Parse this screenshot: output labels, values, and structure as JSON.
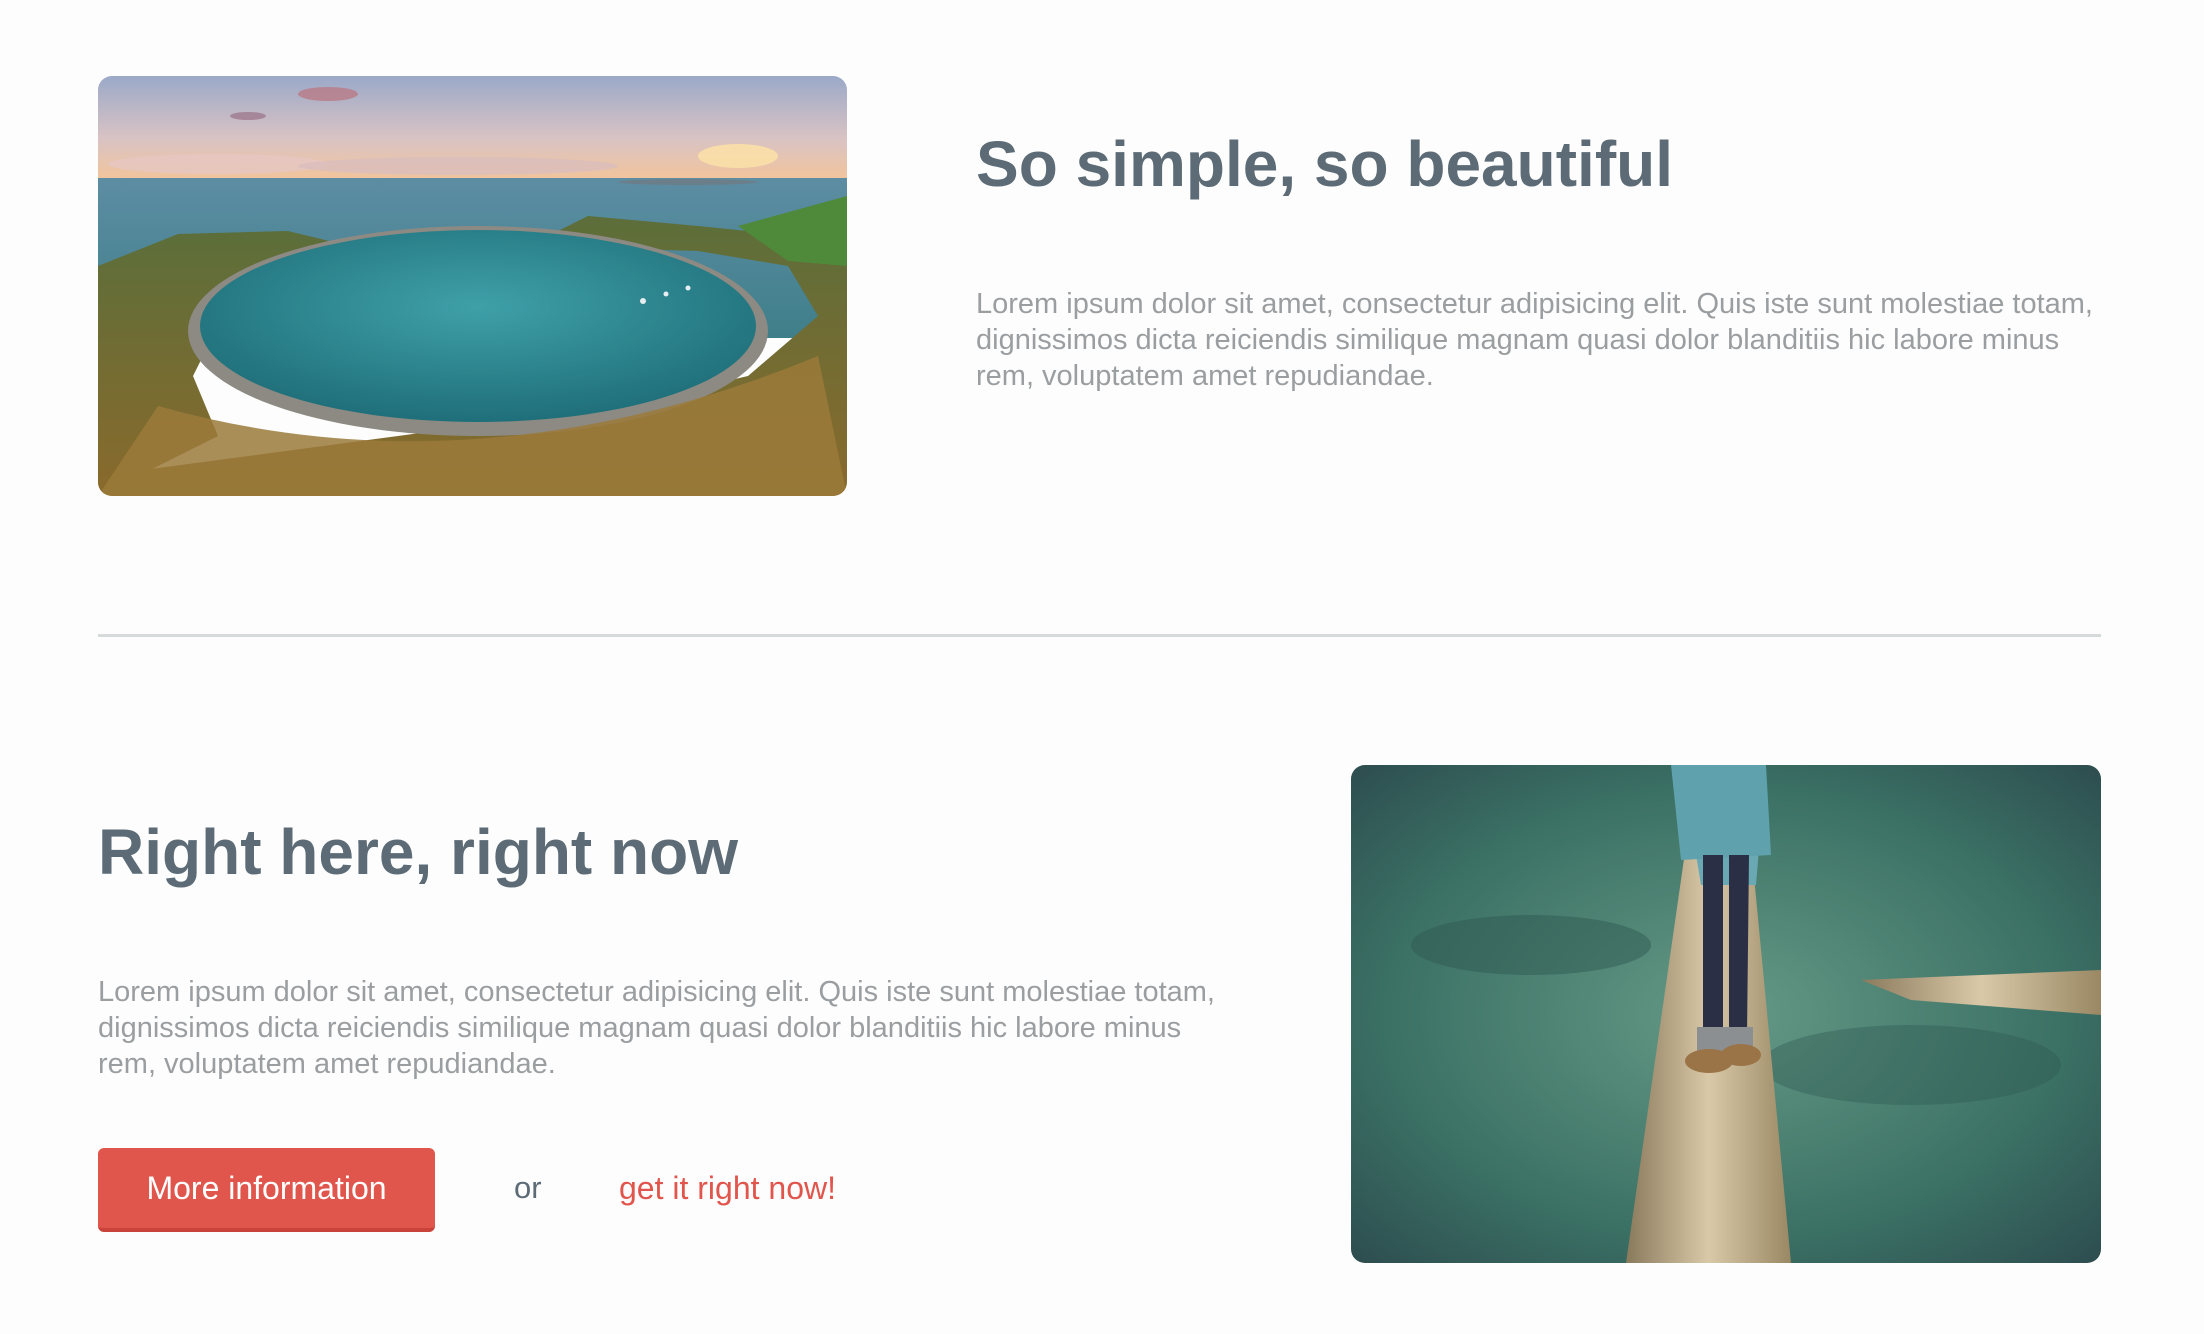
{
  "section_one": {
    "heading": "So simple, so beautiful",
    "body": "Lorem ipsum dolor sit amet, consectetur adipisicing elit. Quis iste sunt molestiae totam, dignissimos dicta reiciendis similique magnam quasi dolor blanditiis hic labore minus rem, voluptatem amet repudiandae."
  },
  "section_two": {
    "heading": "Right here, right now",
    "body": "Lorem ipsum dolor sit amet, consectetur adipisicing elit. Quis iste sunt molestiae totam, dignissimos dicta reiciendis similique magnam quasi dolor blanditiis hic labore minus rem, voluptatem amet repudiandae.",
    "primary_button": "More information",
    "or_text": "or",
    "link_text": "get it right now!"
  },
  "colors": {
    "heading": "#5c6b75",
    "body_text": "#9b9ea0",
    "accent": "#e1564c",
    "divider": "#d7dadb",
    "background": "#fdfdfd"
  }
}
